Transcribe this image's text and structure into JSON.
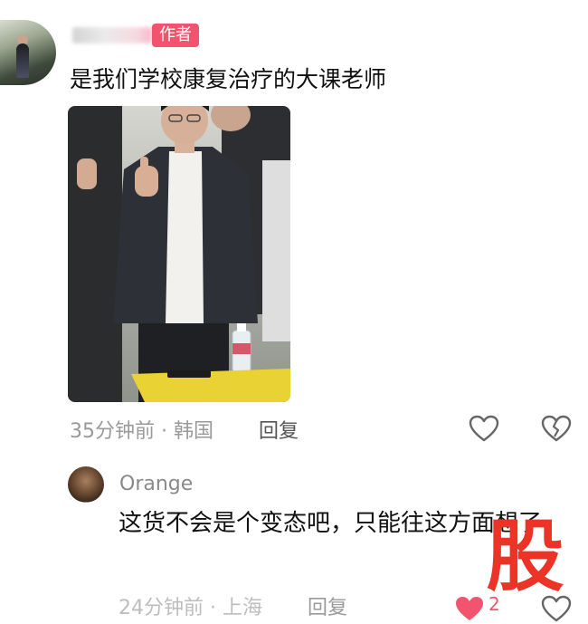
{
  "comment1": {
    "author_badge": "作者",
    "text": "是我们学校康复治疗的大课老师",
    "time": "35分钟前",
    "location": "韩国",
    "separator": "·",
    "reply_label": "回复"
  },
  "comment2": {
    "username": "Orange",
    "text": "这货不会是个变态吧，只能往这方面想了",
    "time": "24分钟前",
    "location": "上海",
    "separator": "·",
    "reply_label": "回复",
    "like_count": "2"
  },
  "watermark": {
    "text": "股"
  },
  "colors": {
    "accent": "#f2546f",
    "watermark": "#ec3328",
    "meta_text": "#9a9a9a"
  },
  "icons": {
    "like": "heart-outline-icon",
    "dislike": "broken-heart-icon",
    "liked": "heart-filled-icon"
  }
}
